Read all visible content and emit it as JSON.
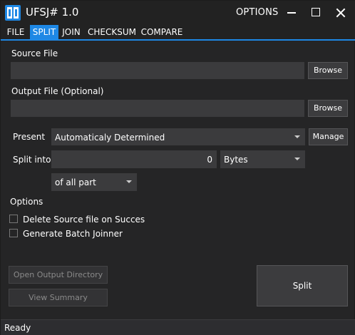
{
  "titlebar": {
    "app_title": "UFSJ# 1.0",
    "options_label": "OPTIONS"
  },
  "menu": {
    "items": [
      {
        "label": "FILE"
      },
      {
        "label": "SPLIT"
      },
      {
        "label": "JOIN"
      },
      {
        "label": "CHECKSUM"
      },
      {
        "label": "COMPARE"
      }
    ],
    "active": "SPLIT"
  },
  "source": {
    "label": "Source File",
    "value": "",
    "browse_label": "Browse"
  },
  "output": {
    "label": "Output File (Optional)",
    "value": "",
    "browse_label": "Browse"
  },
  "preset": {
    "label": "Present",
    "selected": "Automaticaly Determined",
    "manage_label": "Manage"
  },
  "split_into": {
    "label": "Split into",
    "value": "0",
    "unit": "Bytes",
    "scope": "of all part"
  },
  "options": {
    "heading": "Options",
    "delete_source_label": "Delete Source file on Succes",
    "delete_source_checked": false,
    "generate_batch_label": "Generate Batch Joinner",
    "generate_batch_checked": false
  },
  "actions": {
    "open_output_label": "Open Output Directory",
    "view_summary_label": "View Summary",
    "split_label": "Split"
  },
  "status": {
    "text": "Ready"
  },
  "colors": {
    "accent": "#1e88e5",
    "background": "#252526",
    "field": "#3b3b3d"
  }
}
